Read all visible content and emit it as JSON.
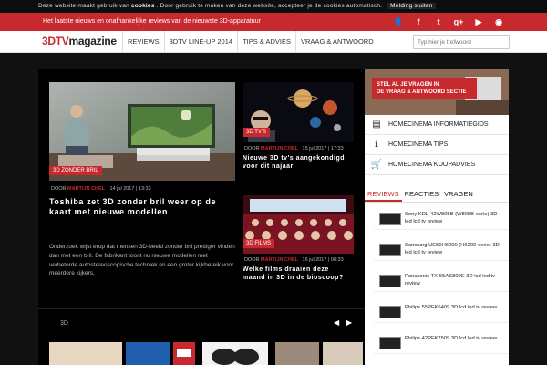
{
  "cookie_bar": {
    "text": "Deze website maakt gebruik van",
    "link": "cookies",
    "text2": ". Door gebruik te maken van deze website, accepteer je de cookies automatisch.",
    "close": "Melding sluiten"
  },
  "top_bar": {
    "tagline": "Het laatste nieuws en onafhankelijke reviews van de nieuwste 3D-apparatuur",
    "social": [
      "user-icon",
      "facebook-icon",
      "twitter-icon",
      "googleplus-icon",
      "youtube-icon",
      "rss-icon"
    ],
    "social_glyphs": [
      "👤",
      "f",
      "t",
      "g+",
      "▶",
      "◉"
    ]
  },
  "nav": {
    "logo_prefix": "3DTV",
    "logo_suffix": "magazine",
    "items": [
      "REVIEWS",
      "3DTV LINE-UP 2014",
      "TIPS & ADVIES",
      "VRAAG & ANTWOORD"
    ],
    "search_placeholder": "Typ hier je trefwoord"
  },
  "features": {
    "main": {
      "category": "3D ZONDER BRIL",
      "author": "MARTIJN CHEL",
      "meta_prefix": "DOOR ",
      "date": "14 jul 2017 | 13:33",
      "headline": "Toshiba zet 3D zonder bril weer op de kaart met nieuwe modellen",
      "excerpt": "Onderzoek wijst erop dat mensen 3D-beeld zonder bril prettiger vinden dan met een bril. De fabrikant toont nu nieuwe modellen met verbeterde autostereoscopische techniek en een groter kijkbereik voor meerdere kijkers."
    },
    "top_right": {
      "category": "3D TV'S",
      "author": "MARTIJN CHEL",
      "meta_prefix": "DOOR ",
      "date": "15 jul 2017 | 17:33",
      "headline": "Nieuwe 3D tv's aangekondigd voor dit najaar"
    },
    "bottom_right": {
      "category": "3D FILMS",
      "author": "MARTIJN CHEL",
      "meta_prefix": "DOOR ",
      "date": "16 jul 2017 | 08:33",
      "headline": "Welke films draaien deze maand in 3D in de bioscoop?"
    }
  },
  "slider": {
    "label": "3D",
    "prev": "◀",
    "next": "▶"
  },
  "sidebar": {
    "promo": {
      "line1": "STEL AL JE VRAGEN IN",
      "line2": "DE VRAAG & ANTWOORD SECTIE"
    },
    "links": [
      {
        "icon": "book-icon",
        "glyph": "▤",
        "label": "HOMECINEMA INFORMATIEGIDS"
      },
      {
        "icon": "info-icon",
        "glyph": "ℹ",
        "label": "HOMECINEMA TIPS"
      },
      {
        "icon": "cart-icon",
        "glyph": "🛒",
        "label": "HOMECINEMA KOOPADVIES"
      }
    ],
    "tabs": [
      "REVIEWS",
      "REACTIES",
      "VRAGEN"
    ],
    "reviews": [
      "Sony KDL-42W805B (W805B-serie) 3D led lcd tv review",
      "Samsung UE50H6200 (H6200-serie) 3D led lcd tv review",
      "Panasonic TX-55AS800E 3D lcd led tv review",
      "Philips 55PFK6409 3D lcd led tv review",
      "Philips 42PFK7509 3D lcd led tv review"
    ]
  },
  "colors": {
    "accent": "#c8292e",
    "background": "#000000"
  }
}
